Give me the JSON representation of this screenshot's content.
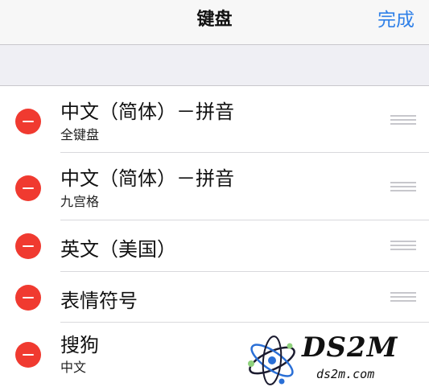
{
  "navbar": {
    "title": "键盘",
    "done_label": "完成"
  },
  "keyboards": [
    {
      "title": "中文（简体）－拼音",
      "subtitle": "全键盘"
    },
    {
      "title": "中文（简体）－拼音",
      "subtitle": "九宫格"
    },
    {
      "title": "英文（美国）",
      "subtitle": ""
    },
    {
      "title": "表情符号",
      "subtitle": ""
    },
    {
      "title": "搜狗",
      "subtitle": "中文"
    }
  ],
  "watermark": {
    "text": "DS2M",
    "url": "ds2m.com"
  },
  "colors": {
    "accent": "#2f80e8",
    "delete": "#f03a30"
  },
  "icons": {
    "delete": "minus-circle-icon",
    "reorder": "reorder-grip-icon",
    "logo": "atom-logo-icon"
  }
}
